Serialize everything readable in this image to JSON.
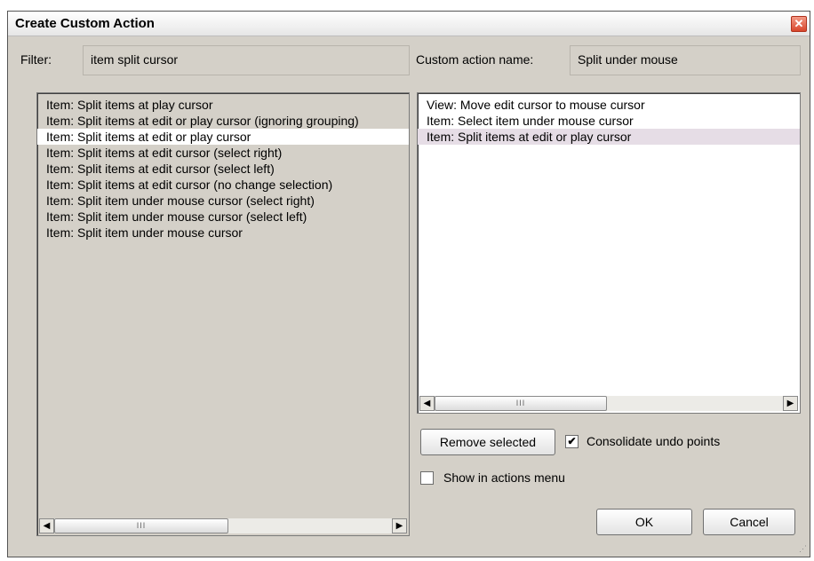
{
  "window": {
    "title": "Create Custom Action",
    "close_glyph": "✕"
  },
  "filter": {
    "label": "Filter:",
    "value": "item split cursor"
  },
  "custom_action": {
    "label": "Custom action name:",
    "value": "Split under mouse"
  },
  "left_list": {
    "items": [
      "Item: Split items at play cursor",
      "Item: Split items at edit or play cursor (ignoring grouping)",
      "Item: Split items at edit or play cursor",
      "Item: Split items at edit cursor (select right)",
      "Item: Split items at edit cursor (select left)",
      "Item: Split items at edit cursor (no change selection)",
      "Item: Split item under mouse cursor (select right)",
      "Item: Split item under mouse cursor (select left)",
      "Item: Split item under mouse cursor"
    ],
    "selected_index": 2
  },
  "right_list": {
    "items": [
      "View: Move edit cursor to mouse cursor",
      "Item: Select item under mouse cursor",
      "Item: Split items at edit or play cursor"
    ],
    "selected_index": 2
  },
  "scrollbar": {
    "left_arrow": "◀",
    "right_arrow": "▶",
    "thumb_glyph": "III"
  },
  "buttons": {
    "remove_selected": "Remove selected",
    "ok": "OK",
    "cancel": "Cancel"
  },
  "options": {
    "consolidate_undo": {
      "label": "Consolidate undo points",
      "checked": true,
      "glyph": "✔"
    },
    "show_in_menu": {
      "label": "Show in actions menu",
      "checked": false
    }
  },
  "colors": {
    "dialog_bg": "#d4d0c8",
    "selected_left": "#ffffff",
    "selected_right": "#e6dde6",
    "close_red": "#d8462c"
  }
}
